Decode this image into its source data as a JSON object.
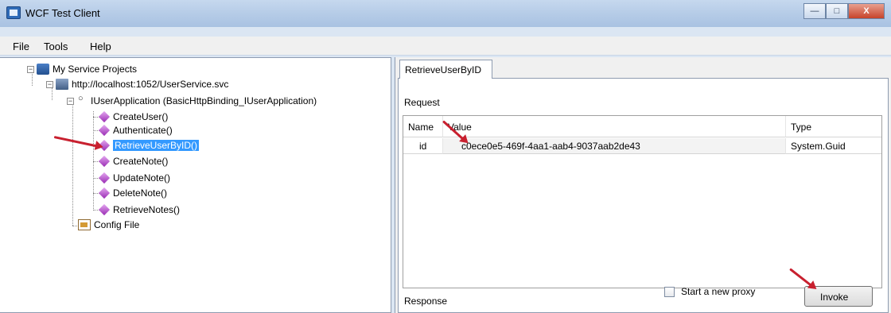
{
  "window": {
    "title": "WCF Test Client",
    "controls": [
      "minimize",
      "maximize",
      "close"
    ]
  },
  "menu": {
    "file": "File",
    "tools": "Tools",
    "help": "Help"
  },
  "tree": {
    "root": "My Service Projects",
    "service": "http://localhost:1052/UserService.svc",
    "interface": "IUserApplication (BasicHttpBinding_IUserApplication)",
    "methods": [
      "CreateUser()",
      "Authenticate()",
      "RetrieveUserByID()",
      "CreateNote()",
      "UpdateNote()",
      "DeleteNote()",
      "RetrieveNotes()"
    ],
    "selected_method": "RetrieveUserByID()",
    "config": "Config File"
  },
  "tab": {
    "label": "RetrieveUserByID"
  },
  "request": {
    "label": "Request",
    "columns": {
      "name": "Name",
      "value": "Value",
      "type": "Type"
    },
    "row": {
      "name": "id",
      "value": "c0ece0e5-469f-4aa1-aab4-9037aab2de43",
      "type": "System.Guid"
    }
  },
  "response": {
    "label": "Response"
  },
  "proxy": {
    "label": "Start a new proxy",
    "checked": false
  },
  "invoke": {
    "label": "Invoke"
  },
  "colors": {
    "selection": "#3399ff",
    "annotation_arrow": "#c8202f",
    "title_bar": "#b7cde8"
  }
}
